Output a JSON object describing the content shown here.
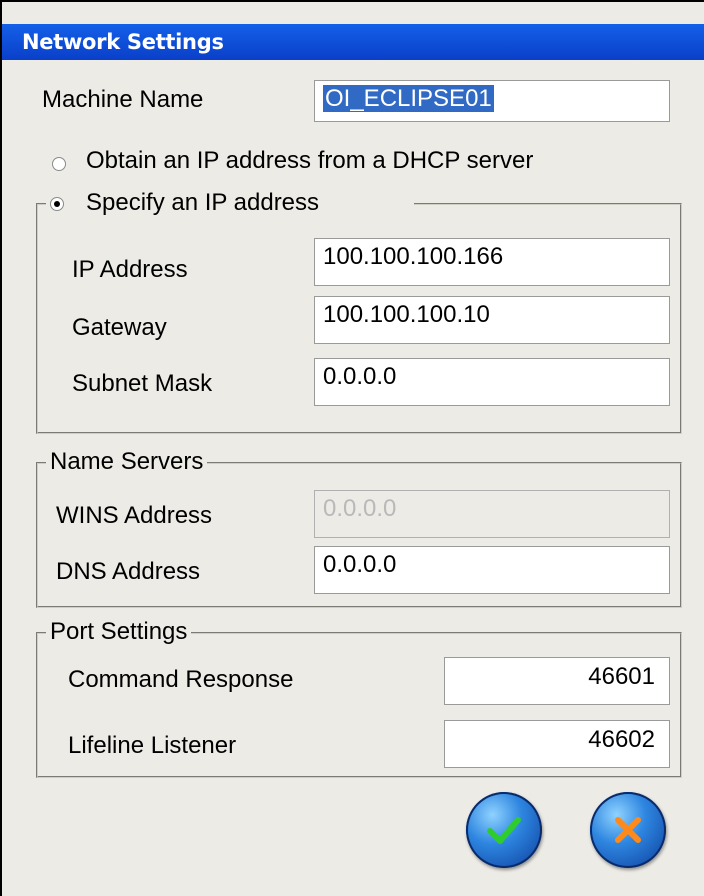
{
  "window": {
    "title": "Network Settings"
  },
  "machine": {
    "label": "Machine Name",
    "value": "OI_ECLIPSE01"
  },
  "ip_mode": {
    "dhcp_label": "Obtain an IP address from a DHCP server",
    "static_label": "Specify an IP address",
    "selected": "static"
  },
  "ip": {
    "address_label": "IP Address",
    "address_value": "100.100.100.166",
    "gateway_label": "Gateway",
    "gateway_value": "100.100.100.10",
    "subnet_label": "Subnet Mask",
    "subnet_value": "0.0.0.0"
  },
  "name_servers": {
    "legend": "Name Servers",
    "wins_label": "WINS Address",
    "wins_value": "0.0.0.0",
    "dns_label": "DNS Address",
    "dns_value": "0.0.0.0"
  },
  "ports": {
    "legend": "Port Settings",
    "command_label": "Command Response",
    "command_value": "46601",
    "lifeline_label": "Lifeline Listener",
    "lifeline_value": "46602"
  },
  "buttons": {
    "ok_icon": "checkmark-icon",
    "cancel_icon": "x-icon",
    "ok_color": "#2ecc2e",
    "cancel_color": "#ff8a1a"
  }
}
